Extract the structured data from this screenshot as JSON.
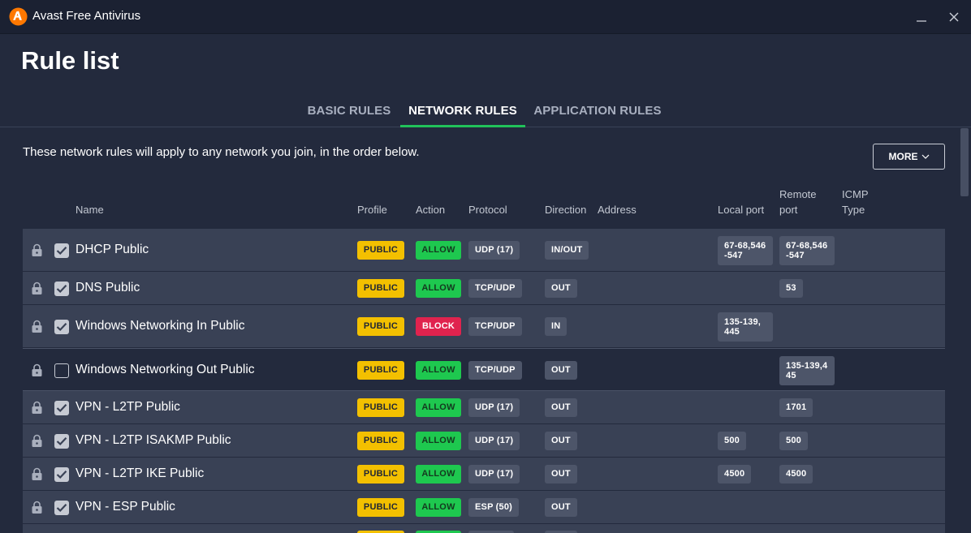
{
  "window": {
    "title": "Avast Free Antivirus",
    "minimize_icon": "minimize-icon",
    "close_icon": "close-icon",
    "brand_color": "#ff7800"
  },
  "page": {
    "title": "Rule list",
    "intro": "These network rules will apply to any network you join, in the order below.",
    "more_label": "MORE"
  },
  "tabs": [
    {
      "label": "BASIC RULES",
      "active": false
    },
    {
      "label": "NETWORK RULES",
      "active": true
    },
    {
      "label": "APPLICATION RULES",
      "active": false
    }
  ],
  "columns": {
    "name": "Name",
    "profile": "Profile",
    "action": "Action",
    "protocol": "Protocol",
    "direction": "Direction",
    "address": "Address",
    "local_port": "Local port",
    "remote_port": "Remote port",
    "icmp_type": "ICMP Type"
  },
  "rules": [
    {
      "enabled": true,
      "name": "DHCP Public",
      "profile": "PUBLIC",
      "action": "ALLOW",
      "protocol": "UDP (17)",
      "direction": "IN/OUT",
      "local_port": "67-68,546-547",
      "remote_port": "67-68,546-547"
    },
    {
      "enabled": true,
      "name": "DNS Public",
      "profile": "PUBLIC",
      "action": "ALLOW",
      "protocol": "TCP/UDP",
      "direction": "OUT",
      "local_port": "",
      "remote_port": "53"
    },
    {
      "enabled": true,
      "name": "Windows Networking In Public",
      "profile": "PUBLIC",
      "action": "BLOCK",
      "protocol": "TCP/UDP",
      "direction": "IN",
      "local_port": "135-139, 445",
      "remote_port": ""
    },
    {
      "enabled": false,
      "name": "Windows Networking Out Public",
      "profile": "PUBLIC",
      "action": "ALLOW",
      "protocol": "TCP/UDP",
      "direction": "OUT",
      "local_port": "",
      "remote_port": "135-139,445"
    },
    {
      "enabled": true,
      "name": "VPN - L2TP Public",
      "profile": "PUBLIC",
      "action": "ALLOW",
      "protocol": "UDP (17)",
      "direction": "OUT",
      "local_port": "",
      "remote_port": "1701"
    },
    {
      "enabled": true,
      "name": "VPN - L2TP ISAKMP Public",
      "profile": "PUBLIC",
      "action": "ALLOW",
      "protocol": "UDP (17)",
      "direction": "OUT",
      "local_port": "500",
      "remote_port": "500"
    },
    {
      "enabled": true,
      "name": "VPN - L2TP IKE Public",
      "profile": "PUBLIC",
      "action": "ALLOW",
      "protocol": "UDP (17)",
      "direction": "OUT",
      "local_port": "4500",
      "remote_port": "4500"
    },
    {
      "enabled": true,
      "name": "VPN - ESP Public",
      "profile": "PUBLIC",
      "action": "ALLOW",
      "protocol": "ESP (50)",
      "direction": "OUT",
      "local_port": "",
      "remote_port": ""
    }
  ],
  "icons": {
    "row_lock": "lock-icon",
    "row_check": "checkmark-icon",
    "more_chevron": "chevron-down-icon"
  }
}
